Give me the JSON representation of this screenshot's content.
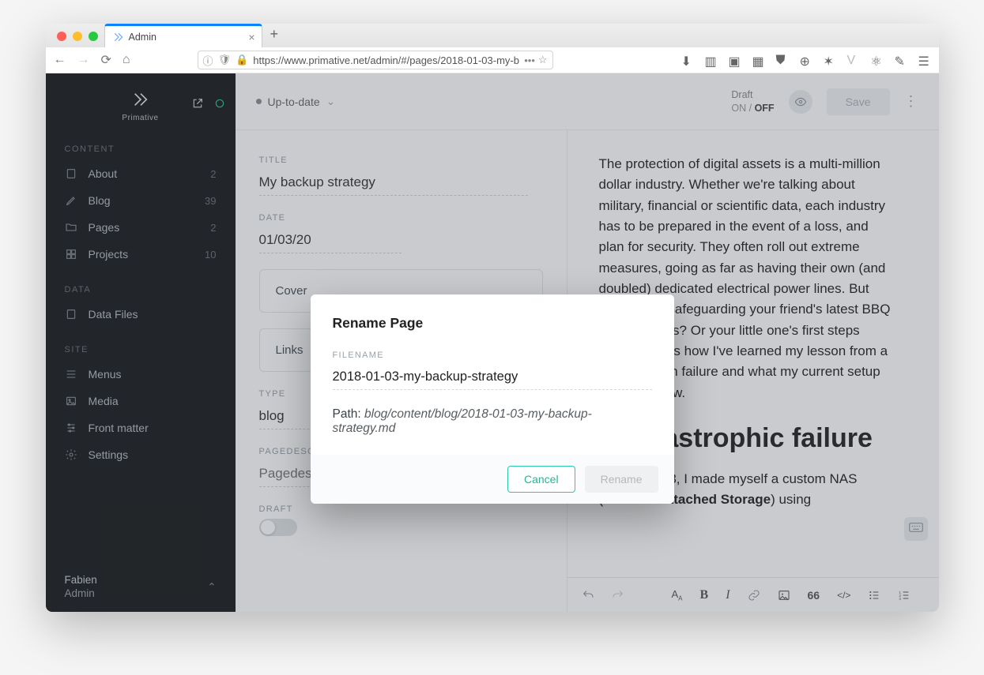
{
  "browser": {
    "tab_title": "Admin",
    "url_display": "https://www.primative.net/admin/#/pages/2018-01-03-my-b"
  },
  "brand": "Primative",
  "sidebar": {
    "sections": {
      "content_label": "CONTENT",
      "data_label": "DATA",
      "site_label": "SITE"
    },
    "content": [
      {
        "label": "About",
        "count": "2"
      },
      {
        "label": "Blog",
        "count": "39"
      },
      {
        "label": "Pages",
        "count": "2"
      },
      {
        "label": "Projects",
        "count": "10"
      }
    ],
    "data": [
      {
        "label": "Data Files"
      }
    ],
    "site": [
      {
        "label": "Menus"
      },
      {
        "label": "Media"
      },
      {
        "label": "Front matter"
      },
      {
        "label": "Settings"
      }
    ],
    "user": {
      "name": "Fabien",
      "role": "Admin"
    }
  },
  "topbar": {
    "status": "Up-to-date",
    "draft_label": "Draft",
    "draft_on": "ON",
    "draft_sep": " / ",
    "draft_off": "OFF",
    "save": "Save"
  },
  "form": {
    "title_label": "TITLE",
    "title_value": "My backup strategy",
    "date_label": "DATE",
    "date_value": "01/03/20",
    "cover_label": "Cover",
    "links_label": "Links",
    "type_label": "TYPE",
    "type_value": "blog",
    "pagedesc_label": "PAGEDESC",
    "pagedesc_placeholder": "Pagedesc goes here...",
    "draft_label": "DRAFT"
  },
  "preview": {
    "para1": "The protection of digital assets is a multi-million dollar industry. Whether we're talking about military, financial or scientific data, each industry has to be prepared in the event of a loss, and plan for security. They often roll out extreme measures, going as far as having their own (and doubled) dedicated electrical power lines. But what about safeguarding your friend's latest BBQ party pictures? Or your little one's first steps video? Here's how I've learned my lesson from a tragic system failure and what my current setup looks like now.",
    "h2": "A catastrophic failure",
    "h2tag": "h2",
    "para2_pre": "Back in 2008, I made myself a custom NAS (",
    "para2_bold": "Network Attached Storage",
    "para2_post": ") using"
  },
  "modal": {
    "title": "Rename Page",
    "filename_label": "FILENAME",
    "filename_value": "2018-01-03-my-backup-strategy",
    "path_prefix": "Path: ",
    "path_value": "blog/content/blog/2018-01-03-my-backup-strategy.md",
    "cancel": "Cancel",
    "rename": "Rename"
  }
}
